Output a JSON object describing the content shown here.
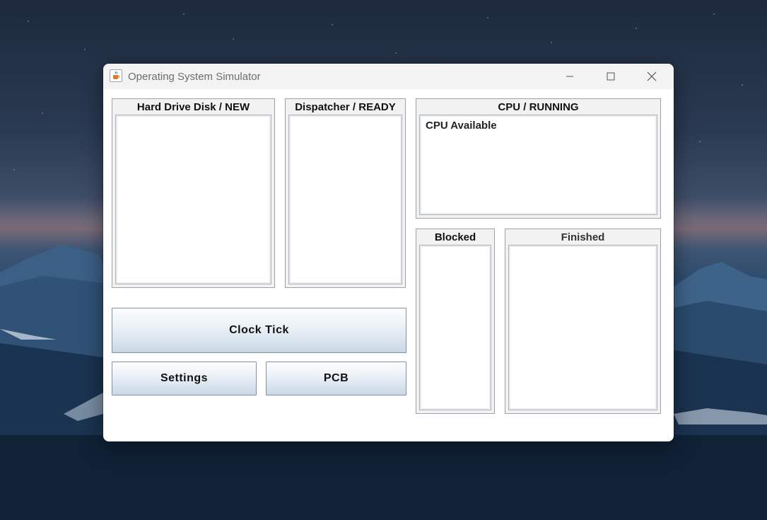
{
  "window": {
    "title": "Operating System Simulator",
    "icon": "java-cup-icon",
    "controls": [
      "minimize-icon",
      "maximize-icon",
      "close-icon"
    ]
  },
  "panels": {
    "new": {
      "title": "Hard Drive Disk / NEW",
      "items": []
    },
    "ready": {
      "title": "Dispatcher / READY",
      "items": []
    },
    "running": {
      "title": "CPU / RUNNING",
      "status": "CPU Available"
    },
    "blocked": {
      "title": "Blocked",
      "items": []
    },
    "finished": {
      "title": "Finished",
      "items": []
    }
  },
  "buttons": {
    "clock_tick": "Clock Tick",
    "settings": "Settings",
    "pcb": "PCB"
  },
  "colors": {
    "window_bg": "#ffffff",
    "titlebar_bg": "#f3f3f3",
    "button_gradient_top": "#fdfeff",
    "button_gradient_bottom": "#c9d7e5"
  }
}
